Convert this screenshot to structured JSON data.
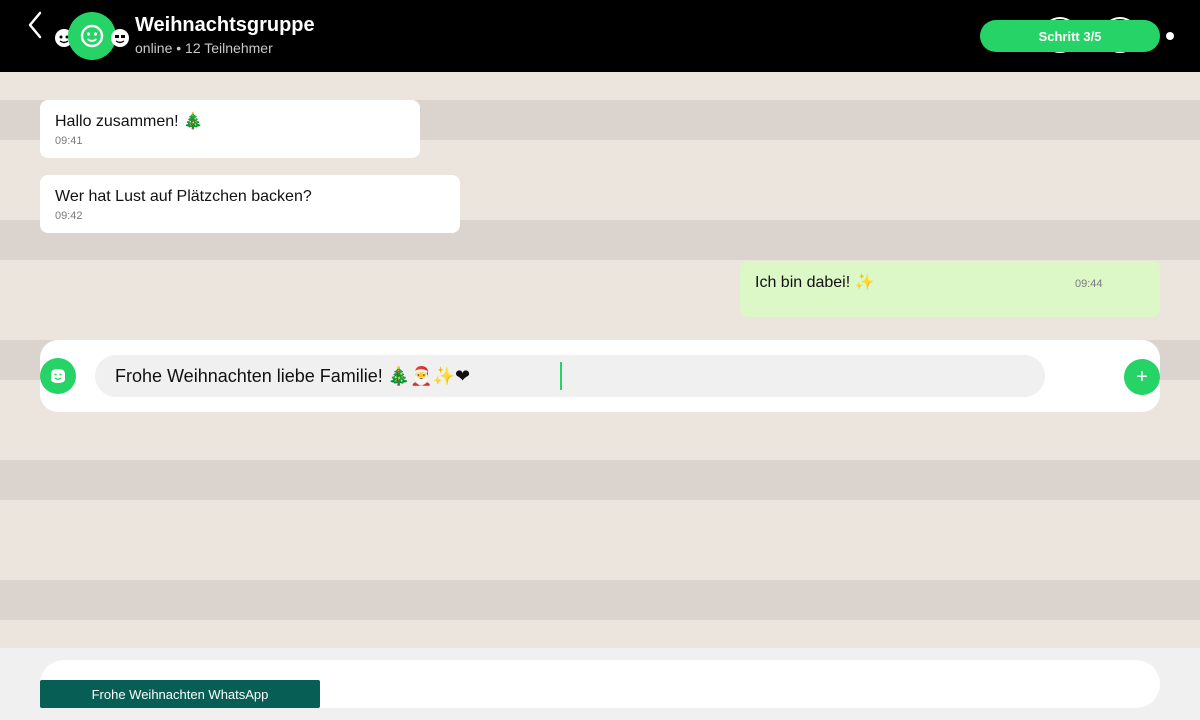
{
  "header": {
    "title": "Weihnachtsgruppe",
    "subtitle": "online • 12 Teilnehmer",
    "step_label": "Schritt 3/5"
  },
  "messages": [
    {
      "direction": "in",
      "text": "Hallo zusammen! 🎄",
      "time": "09:41"
    },
    {
      "direction": "in",
      "text": "Wer hat Lust auf Plätzchen backen?",
      "time": "09:42"
    },
    {
      "direction": "out",
      "text": "Ich bin dabei! ✨",
      "time": "09:44"
    }
  ],
  "compose": {
    "value": "Frohe Weihnachten liebe Familie! 🎄🎅✨❤"
  },
  "bottom_bar": {
    "label": "Frohe Weihnachten WhatsApp"
  },
  "colors": {
    "accent": "#25d366",
    "header_bg": "#000000",
    "chat_bg": "#ece5dd",
    "outgoing_bubble": "#dcf8c6",
    "bottom_label_bg": "#075e54"
  },
  "icons": {
    "back": "chevron-left-icon",
    "group_avatar": "group-avatar-icon",
    "emoji": "emoji-face-icon",
    "attach": "plus-icon"
  }
}
